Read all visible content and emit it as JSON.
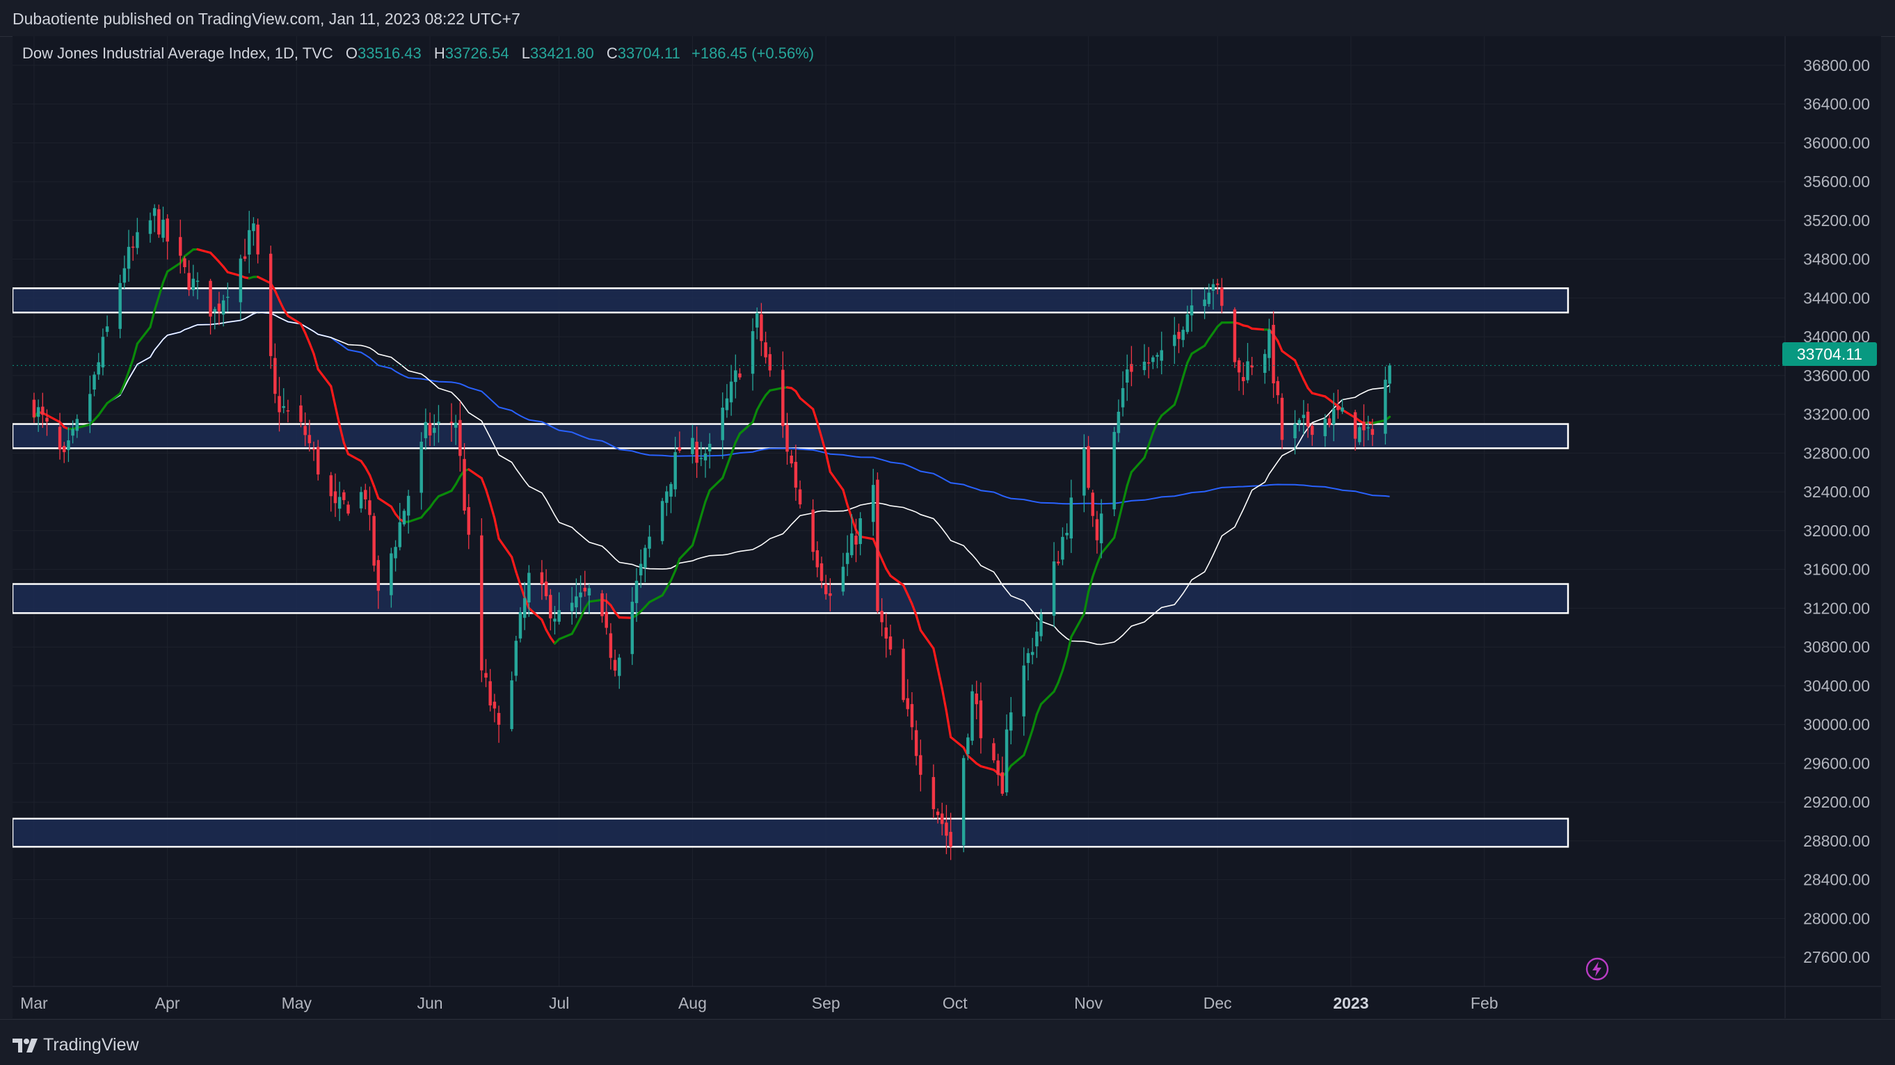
{
  "header": {
    "published": "Dubaotiente published on TradingView.com, Jan 11, 2023 08:22 UTC+7"
  },
  "legend": {
    "symbol": "Dow Jones Industrial Average Index, 1D, TVC",
    "open_label": "O",
    "open": "33516.43",
    "high_label": "H",
    "high": "33726.54",
    "low_label": "L",
    "low": "33421.80",
    "close_label": "C",
    "close": "33704.11",
    "change": "+186.45 (+0.56%)"
  },
  "last_price": "33704.11",
  "footer": {
    "brand": "TradingView"
  },
  "icons": {
    "brand": "tradingview-logo-icon",
    "flash": "lightning-icon"
  },
  "colors": {
    "background": "#131722",
    "up": "#26a69a",
    "down": "#f23645",
    "zone_fill": "#1c2b52",
    "zone_border": "#ffffff",
    "ma_fast_up": "#0a8a0a",
    "ma_fast_down": "#ff1a1a",
    "ma_mid": "#ffffff",
    "ma_slow": "#2962ff"
  },
  "chart_data": {
    "type": "candlestick",
    "title": "Dow Jones Industrial Average Index, 1D, TVC",
    "grid": true,
    "x_axis_labels": [
      "Mar",
      "Apr",
      "May",
      "Jun",
      "Jul",
      "Aug",
      "Sep",
      "Oct",
      "Nov",
      "Dec",
      "2023",
      "Feb"
    ],
    "y_ticks": [
      27600,
      28000,
      28400,
      28800,
      29200,
      29600,
      30000,
      30400,
      30800,
      31200,
      31600,
      32000,
      32400,
      32800,
      33200,
      33600,
      34000,
      34400,
      34800,
      35200,
      35600,
      36000,
      36400,
      36800
    ],
    "ylim": [
      27300,
      37100
    ],
    "zones": [
      {
        "low": 34250,
        "high": 34500
      },
      {
        "low": 32850,
        "high": 33100
      },
      {
        "low": 31150,
        "high": 31450
      },
      {
        "low": 28740,
        "high": 29030
      }
    ],
    "anchors": [
      {
        "date": "2022-03-01",
        "c": 33300
      },
      {
        "date": "2022-03-08",
        "c": 32700
      },
      {
        "date": "2022-03-15",
        "c": 33550
      },
      {
        "date": "2022-03-22",
        "c": 34750
      },
      {
        "date": "2022-03-29",
        "c": 35250
      },
      {
        "date": "2022-04-05",
        "c": 34650
      },
      {
        "date": "2022-04-12",
        "c": 34250
      },
      {
        "date": "2022-04-19",
        "c": 34900
      },
      {
        "date": "2022-04-21",
        "c": 35100
      },
      {
        "date": "2022-04-26",
        "c": 33350
      },
      {
        "date": "2022-05-03",
        "c": 33000
      },
      {
        "date": "2022-05-10",
        "c": 32200
      },
      {
        "date": "2022-05-17",
        "c": 32400
      },
      {
        "date": "2022-05-20",
        "c": 31300
      },
      {
        "date": "2022-05-31",
        "c": 33000
      },
      {
        "date": "2022-06-07",
        "c": 33150
      },
      {
        "date": "2022-06-13",
        "c": 30550
      },
      {
        "date": "2022-06-17",
        "c": 29900
      },
      {
        "date": "2022-06-24",
        "c": 31500
      },
      {
        "date": "2022-07-01",
        "c": 31100
      },
      {
        "date": "2022-07-08",
        "c": 31350
      },
      {
        "date": "2022-07-14",
        "c": 30650
      },
      {
        "date": "2022-07-22",
        "c": 31900
      },
      {
        "date": "2022-07-29",
        "c": 32850
      },
      {
        "date": "2022-08-05",
        "c": 32800
      },
      {
        "date": "2022-08-12",
        "c": 33700
      },
      {
        "date": "2022-08-16",
        "c": 34150
      },
      {
        "date": "2022-08-22",
        "c": 33050
      },
      {
        "date": "2022-08-26",
        "c": 32300
      },
      {
        "date": "2022-09-02",
        "c": 31300
      },
      {
        "date": "2022-09-12",
        "c": 32400
      },
      {
        "date": "2022-09-13",
        "c": 31150
      },
      {
        "date": "2022-09-23",
        "c": 29600
      },
      {
        "date": "2022-09-30",
        "c": 28750
      },
      {
        "date": "2022-10-05",
        "c": 30300
      },
      {
        "date": "2022-10-12",
        "c": 29200
      },
      {
        "date": "2022-10-13",
        "c": 30050
      },
      {
        "date": "2022-10-21",
        "c": 31100
      },
      {
        "date": "2022-10-31",
        "c": 32750
      },
      {
        "date": "2022-11-03",
        "c": 32000
      },
      {
        "date": "2022-11-10",
        "c": 33700
      },
      {
        "date": "2022-11-18",
        "c": 33750
      },
      {
        "date": "2022-11-25",
        "c": 34350
      },
      {
        "date": "2022-11-30",
        "c": 34600
      },
      {
        "date": "2022-12-06",
        "c": 33600
      },
      {
        "date": "2022-12-13",
        "c": 33950
      },
      {
        "date": "2022-12-16",
        "c": 32950
      },
      {
        "date": "2022-12-22",
        "c": 33100
      },
      {
        "date": "2022-12-29",
        "c": 33200
      },
      {
        "date": "2023-01-05",
        "c": 32950
      },
      {
        "date": "2023-01-10",
        "c": 33704.11
      }
    ],
    "last_candle": {
      "date": "2023-01-10",
      "o": 33516.43,
      "h": 33726.54,
      "l": 33421.8,
      "c": 33704.11,
      "change": 186.45,
      "change_pct": 0.56
    },
    "moving_averages": [
      {
        "name": "",
        "color": "#0a8a0a",
        "down_color": "#ff1a1a",
        "kind": "fast"
      },
      {
        "name": "",
        "color": "#ffffff",
        "kind": "mid"
      },
      {
        "name": "",
        "color": "#2962ff",
        "kind": "slow"
      }
    ]
  }
}
